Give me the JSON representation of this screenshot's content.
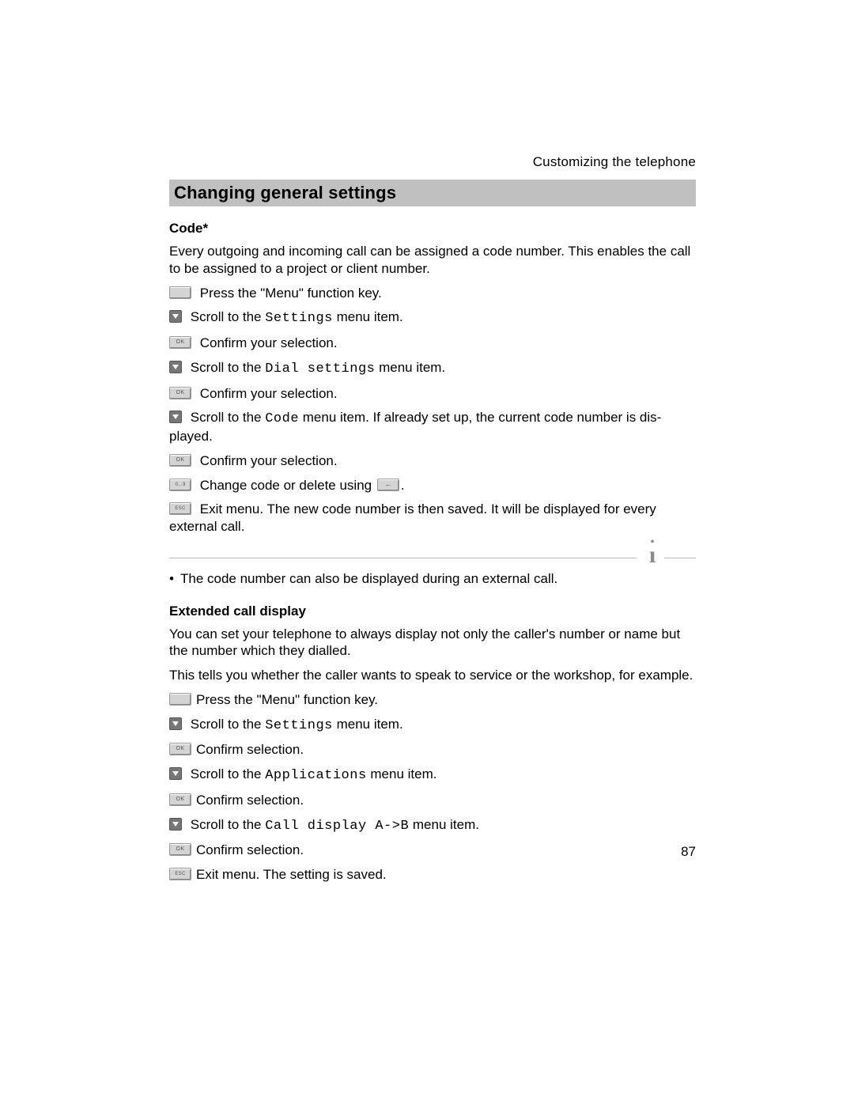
{
  "header": {
    "running_title": "Customizing the telephone"
  },
  "title": "Changing general settings",
  "section1": {
    "heading": "Code*",
    "intro": "Every outgoing and incoming call can be assigned a code number. This enables the call to be assigned to a project or client number.",
    "steps": {
      "s1": "Press the \"Menu\" function key.",
      "s2a": "Scroll to the ",
      "s2m": "Settings",
      "s2b": " menu item.",
      "s3": "Confirm your selection.",
      "s4a": "Scroll to the ",
      "s4m": "Dial settings",
      "s4b": " menu item.",
      "s5": "Confirm your selection.",
      "s6a": "Scroll to the ",
      "s6m": "Code",
      "s6b": " menu item. If already set up, the current code number is dis­played.",
      "s7": "Confirm your selection.",
      "s8a": "Change code or delete using ",
      "s8b": ".",
      "s9": "Exit menu. The new code number is then saved. It will be displayed for every external call."
    },
    "note": "The code number can also be displayed during an external call."
  },
  "section2": {
    "heading": "Extended call display",
    "intro1": "You can set your telephone to always display not only the caller's number or name but the number which they dialled.",
    "intro2": "This tells you whether the caller wants to speak to service or the workshop, for example.",
    "steps": {
      "s1": "Press the \"Menu\" function key.",
      "s2a": "Scroll to the ",
      "s2m": "Settings",
      "s2b": " menu item.",
      "s3": "Confirm selection.",
      "s4a": "Scroll to the ",
      "s4m": "Applications",
      "s4b": " menu item.",
      "s5": "Confirm selection.",
      "s6a": "Scroll to the ",
      "s6m": "Call display A->B",
      "s6b": " menu item.",
      "s7": "Confirm selection.",
      "s8": "Exit menu. The setting is saved."
    }
  },
  "page_number": "87"
}
